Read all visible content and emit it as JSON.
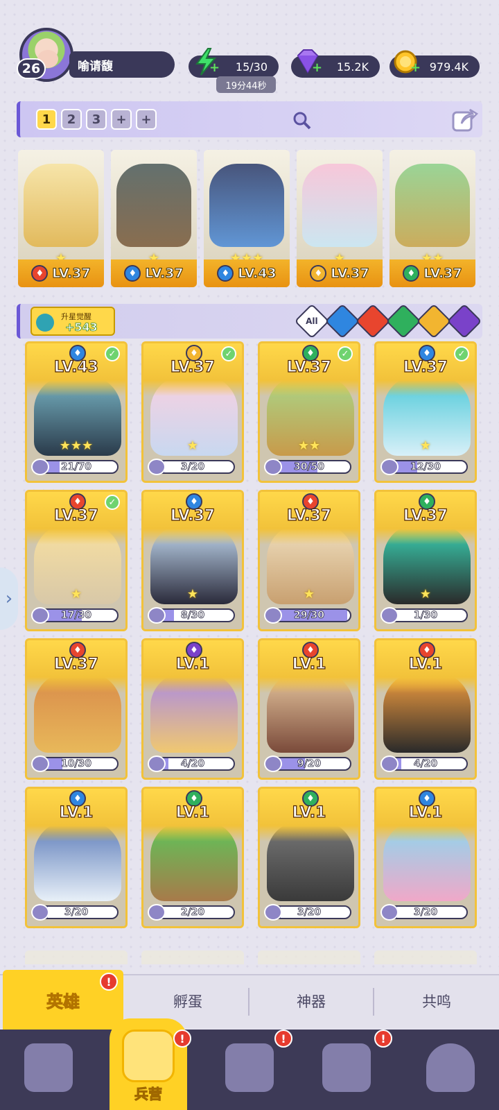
{
  "player": {
    "level": "26",
    "name": "喻请馥"
  },
  "resources": {
    "energy": "15/30",
    "energy_timer": "19分44秒",
    "gems": "15.2K",
    "gold": "979.4K"
  },
  "team_tabs": [
    "1",
    "2",
    "3",
    "+",
    "+"
  ],
  "team": [
    {
      "element": "fire",
      "level": "LV.37",
      "stars": "★"
    },
    {
      "element": "water",
      "level": "LV.37",
      "stars": "★"
    },
    {
      "element": "water",
      "level": "LV.43",
      "stars": "★★★"
    },
    {
      "element": "light",
      "level": "LV.37",
      "stars": "★"
    },
    {
      "element": "wind",
      "level": "LV.37",
      "stars": "★★"
    }
  ],
  "awaken": {
    "label": "升星觉醒",
    "count": "+543"
  },
  "filters": [
    "All",
    "water",
    "fire",
    "wind",
    "light",
    "dark"
  ],
  "heroes": [
    {
      "element": "water",
      "level": "LV.43",
      "progress": "21/70",
      "checked": true,
      "stars": "★★★"
    },
    {
      "element": "light",
      "level": "LV.37",
      "progress": "3/20",
      "checked": true,
      "stars": "★"
    },
    {
      "element": "wind",
      "level": "LV.37",
      "progress": "30/50",
      "checked": true,
      "stars": "★★"
    },
    {
      "element": "water",
      "level": "LV.37",
      "progress": "12/30",
      "checked": true,
      "stars": "★"
    },
    {
      "element": "fire",
      "level": "LV.37",
      "progress": "17/30",
      "checked": true,
      "stars": "★"
    },
    {
      "element": "water",
      "level": "LV.37",
      "progress": "8/30",
      "checked": false,
      "stars": "★"
    },
    {
      "element": "fire",
      "level": "LV.37",
      "progress": "29/30",
      "checked": false,
      "stars": "★"
    },
    {
      "element": "wind",
      "level": "LV.37",
      "progress": "1/30",
      "checked": false,
      "stars": "★"
    },
    {
      "element": "fire",
      "level": "LV.37",
      "progress": "10/30",
      "checked": false,
      "stars": ""
    },
    {
      "element": "dark",
      "level": "LV.1",
      "progress": "4/20",
      "checked": false,
      "stars": ""
    },
    {
      "element": "fire",
      "level": "LV.1",
      "progress": "9/20",
      "checked": false,
      "stars": ""
    },
    {
      "element": "fire",
      "level": "LV.1",
      "progress": "4/20",
      "checked": false,
      "stars": ""
    },
    {
      "element": "water",
      "level": "LV.1",
      "progress": "3/20",
      "checked": false,
      "stars": ""
    },
    {
      "element": "wind",
      "level": "LV.1",
      "progress": "2/20",
      "checked": false,
      "stars": ""
    },
    {
      "element": "wind",
      "level": "LV.1",
      "progress": "3/20",
      "checked": false,
      "stars": ""
    },
    {
      "element": "water",
      "level": "LV.1",
      "progress": "3/20",
      "checked": false,
      "stars": ""
    }
  ],
  "sub_tabs": [
    "英雄",
    "孵蛋",
    "神器",
    "共鸣"
  ],
  "nav": {
    "active_label": "兵营"
  },
  "badges": {
    "alert": "!"
  },
  "colors": {
    "accent": "#ffd125",
    "panel": "#3a3859",
    "fire": "#e8452e",
    "water": "#2f86e0",
    "wind": "#2fb05d",
    "light": "#f2b530",
    "dark": "#7a42c9"
  }
}
